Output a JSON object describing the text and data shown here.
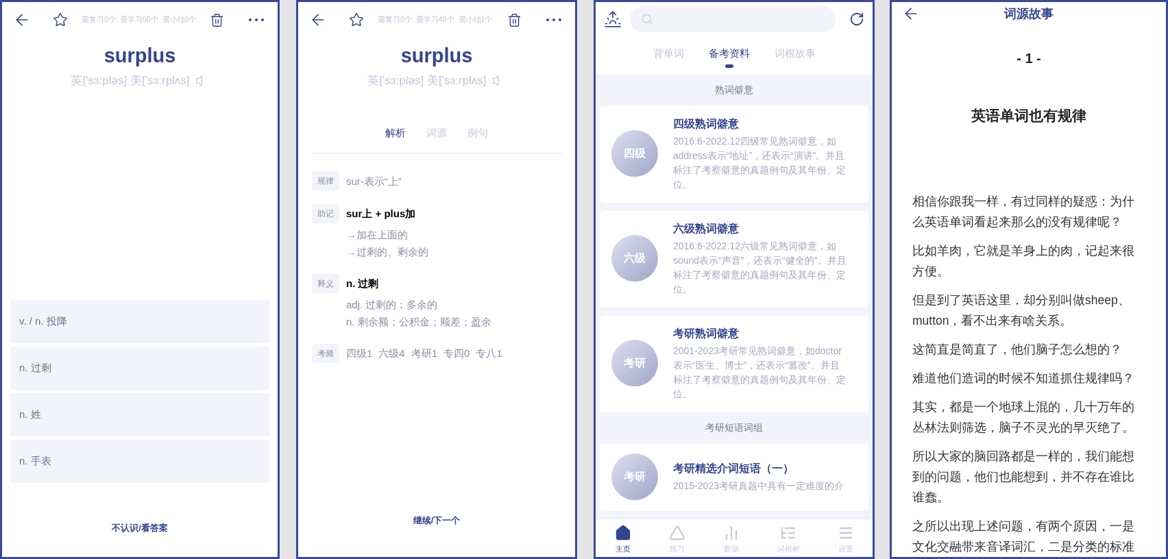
{
  "word_card": {
    "stats": [
      "需复习0个",
      "需学习50个",
      "需小结0个"
    ],
    "word": "surplus",
    "phonetic": "英['sɜ:pləs] 美['sɜ:rplʌs]",
    "options": [
      "v. / n. 投降",
      "n. 过剩",
      "n. 姓",
      "n. 手表"
    ],
    "action": "不认识/看答案"
  },
  "word_detail": {
    "stats": [
      "需复习0个",
      "需学习49个",
      "需小结1个"
    ],
    "word": "surplus",
    "phonetic": "英['sɜ:pləs] 美['sɜ:rplʌs]",
    "tabs": [
      {
        "label": "解析",
        "selected": true
      },
      {
        "label": "词源",
        "selected": false
      },
      {
        "label": "例句",
        "selected": false
      }
    ],
    "sections": [
      {
        "tag": "规律",
        "lines": [
          "sur-表示“上”"
        ]
      },
      {
        "tag": "助记",
        "heading": "sur上 + plus加",
        "lines": [
          "→加在上面的",
          "→过剩的、剩余的"
        ]
      },
      {
        "tag": "释义",
        "heading": "n. 过剩",
        "lines": [
          "adj. 过剩的；多余的",
          "n. 剩余额；公积金；顺差；盈余"
        ]
      },
      {
        "tag": "考频",
        "items": [
          "四级1",
          "六级4",
          "考研1",
          "专四0",
          "专八1"
        ]
      }
    ],
    "action": "继续/下一个"
  },
  "home": {
    "tabs": [
      {
        "label": "背单词",
        "selected": false
      },
      {
        "label": "备考资料",
        "selected": true
      },
      {
        "label": "词根故事",
        "selected": false
      }
    ],
    "groups": [
      {
        "title": "熟词僻意",
        "cards": [
          {
            "badge": "四级",
            "title": "四级熟词僻意",
            "description": "2016.6-2022.12四级常见熟词僻意，如address表示“地址”，还表示“演讲”。并且标注了考察僻意的真题例句及其年份、定位。"
          },
          {
            "badge": "六级",
            "title": "六级熟词僻意",
            "description": "2016.6-2022.12六级常见熟词僻意，如sound表示“声音”，还表示“健全的”。并且标注了考察僻意的真题例句及其年份、定位。"
          },
          {
            "badge": "考研",
            "title": "考研熟词僻意",
            "description": "2001-2023考研常见熟词僻意，如doctor表示“医生、博士”，还表示“篡改”。并且标注了考察僻意的真题例句及其年份、定位。"
          }
        ]
      },
      {
        "title": "考研短语词组",
        "cards": [
          {
            "badge": "考研",
            "title": "考研精选介词短语（一）",
            "description": "2015-2023考研真题中具有一定难度的介"
          }
        ]
      }
    ],
    "nav": [
      {
        "label": "主页",
        "selected": true
      },
      {
        "label": "练习",
        "selected": false
      },
      {
        "label": "数据",
        "selected": false
      },
      {
        "label": "词根树",
        "selected": false
      },
      {
        "label": "设置",
        "selected": false
      }
    ]
  },
  "story": {
    "title": "词源故事",
    "number": "- 1 -",
    "heading": "英语单词也有规律",
    "paragraphs": [
      "相信你跟我一样，有过同样的疑惑：为什么英语单词看起来那么的没有规律呢？",
      "比如羊肉，它就是羊身上的肉，记起来很方便。",
      "但是到了英语这里，却分别叫做sheep、mutton，看不出来有啥关系。",
      "这简直是简直了，他们脑子怎么想的？",
      "难道他们造词的时候不知道抓住规律吗？",
      "其实，都是一个地球上混的，几十万年的丛林法则筛选，脑子不灵光的早灭绝了。",
      "所以大家的脑回路都是一样的，我们能想到的问题，他们也能想到，并不存在谁比谁蠢。",
      "之所以出现上述问题，有两个原因，一是文化交融带来音译词汇，二是分类的标准"
    ]
  }
}
